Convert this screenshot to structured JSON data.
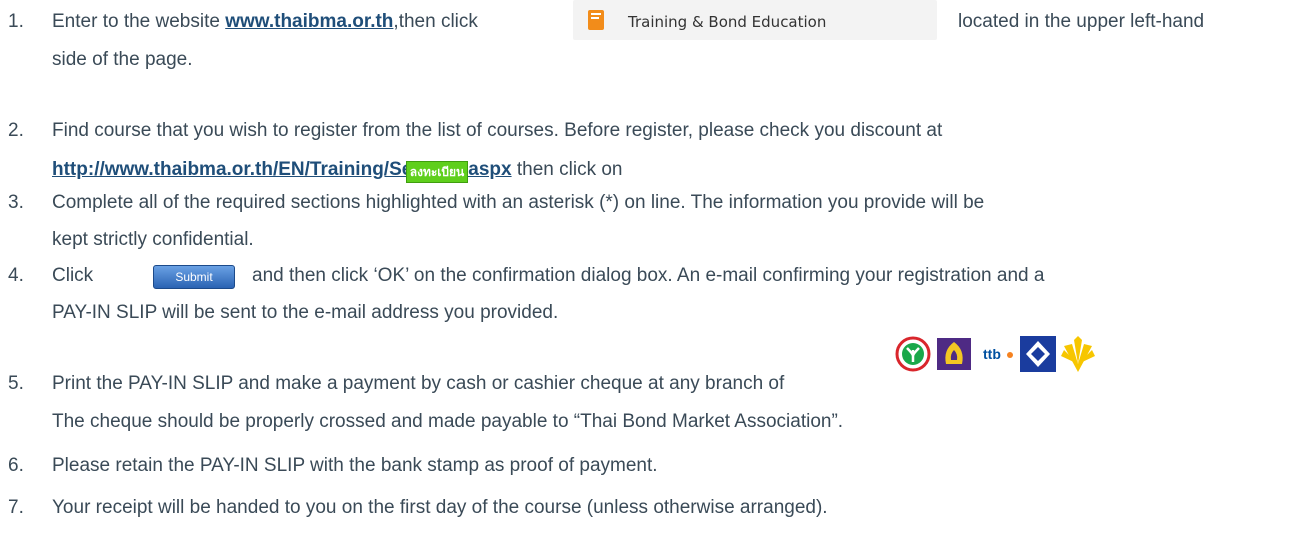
{
  "steps": [
    {
      "number": "1.",
      "line1_prefix": "Enter to the website ",
      "link": "www.thaibma.or.th",
      "line1_mid": ",then click ",
      "button_label": "Training & Bond Education",
      "line1_suffix": "located in the upper left-hand",
      "line2": "side of the page."
    },
    {
      "number": "2.",
      "line1": "Find course that you wish to register from the list of courses. Before register, please check you discount at",
      "link": "http://www.thaibma.or.th/EN/Training/Seminar.aspx",
      "line2_suffix": " then click on",
      "register_label": "ลงทะเบียน"
    },
    {
      "number": "3.",
      "line1": "Complete all of the required sections highlighted with an asterisk (*) on line. The information you provide will be",
      "line2": "kept strictly confidential."
    },
    {
      "number": "4.",
      "prefix": "Click",
      "submit_label": "Submit",
      "line1_suffix": "and then click ‘OK’ on the confirmation dialog box. An e-mail confirming your registration and a",
      "line2": "PAY-IN SLIP will be sent to the e-mail address you provided."
    },
    {
      "number": "5.",
      "line1": "Print the PAY-IN SLIP and make a payment by cash or cashier cheque at any branch of",
      "line2": "The cheque should be properly crossed and made payable to “Thai Bond Market Association”.",
      "banks": [
        {
          "name": "kasikornbank-logo",
          "color": "#1aa84a"
        },
        {
          "name": "scb-logo",
          "color": "#4e2a84"
        },
        {
          "name": "ttb-logo",
          "color": "#0050a0",
          "text": "ttb"
        },
        {
          "name": "bangkok-bank-logo",
          "color": "#1a3c9e"
        },
        {
          "name": "krungsri-logo",
          "color": "#f7c600"
        }
      ]
    },
    {
      "number": "6.",
      "line1": "Please retain the PAY-IN SLIP with the bank stamp as proof of payment."
    },
    {
      "number": "7.",
      "line1": "Your receipt will be handed to you on the first day of the course (unless otherwise arranged)."
    }
  ]
}
